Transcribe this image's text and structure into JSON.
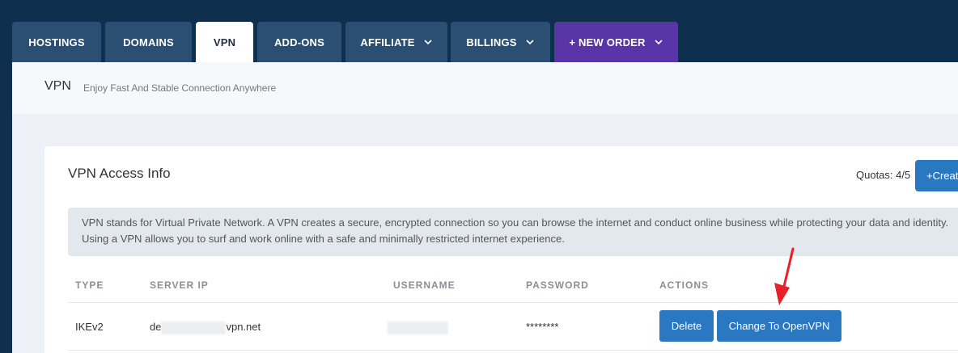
{
  "nav": {
    "tabs": [
      {
        "label": "HOSTINGS"
      },
      {
        "label": "DOMAINS"
      },
      {
        "label": "VPN"
      },
      {
        "label": "ADD-ONS"
      },
      {
        "label": "AFFILIATE"
      },
      {
        "label": "BILLINGS"
      },
      {
        "label": "+ NEW ORDER"
      }
    ]
  },
  "header": {
    "title": "VPN",
    "subtitle": "Enjoy Fast And Stable Connection Anywhere"
  },
  "card": {
    "title": "VPN Access Info",
    "quotas": "Quotas: 4/5",
    "create_label": "+Create",
    "info": "VPN stands for Virtual Private Network. A VPN creates a secure, encrypted connection so you can browse the internet and conduct online business while protecting your data and identity. Using a VPN allows you to surf and work online with a safe and minimally restricted internet experience."
  },
  "table": {
    "headers": [
      "TYPE",
      "SERVER IP",
      "USERNAME",
      "PASSWORD",
      "ACTIONS"
    ],
    "rows": [
      {
        "type": "IKEv2",
        "server_prefix": "de",
        "server_suffix": "vpn.net",
        "password": "********",
        "delete_label": "Delete",
        "change_label": "Change To OpenVPN"
      }
    ]
  },
  "colors": {
    "nav_bg": "#0f2f4f",
    "tab_bg": "#2b4f72",
    "accent_purple": "#5a35a8",
    "button_blue": "#2a78c2",
    "annotation_red": "#e8202a"
  }
}
